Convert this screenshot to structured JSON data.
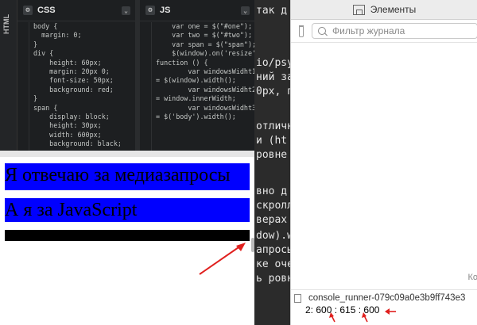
{
  "editor": {
    "html_tab": "HTML",
    "css": {
      "title": "CSS",
      "lines": [
        "body {",
        "  margin: 0;",
        "",
        "}",
        "div {",
        "    height: 60px;",
        "    margin: 20px 0;",
        "    font-size: 50px;",
        "    background: red;",
        "}",
        "span {",
        "    display: block;",
        "    height: 30px;",
        "    width: 600px;",
        "    background: black;"
      ]
    },
    "js": {
      "title": "JS",
      "lines": [
        "    var one = $(\"#one\");",
        "    var two = $(\"#two\");",
        "",
        "    var span = $(\"span\");",
        "",
        "",
        "",
        "    $(window).on('resize',",
        "function () {",
        "        var windowsWidht1",
        "= $(window).width();",
        "        var windowsWidht2",
        "= window.innerWidth;",
        "        var windowsWidht3",
        "= $('body').width();"
      ]
    }
  },
  "preview": {
    "block1_text": "Я отвечаю за медиазапросы",
    "block2_text": "А я за JavaScript"
  },
  "background_page": {
    "lines": [
      "так д",
      "io/psy",
      "ний за",
      "0px, п",
      "отличн",
      "и (ht",
      "ровне",
      "вно д",
      "скролл",
      "верах",
      "dow).w",
      "апросы",
      "ке оче",
      "ь ровн"
    ]
  },
  "console": {
    "tab_label": "Элементы",
    "filter_placeholder": "Фильтр журнала",
    "truncated_label": "Ко",
    "message_source": "console_runner-079c09a0e3b9ff743e3",
    "message_output": "2: 600 : 615 : 600"
  },
  "colors": {
    "preview_block": "#0000ff",
    "annotation_arrow": "#e0201e"
  }
}
